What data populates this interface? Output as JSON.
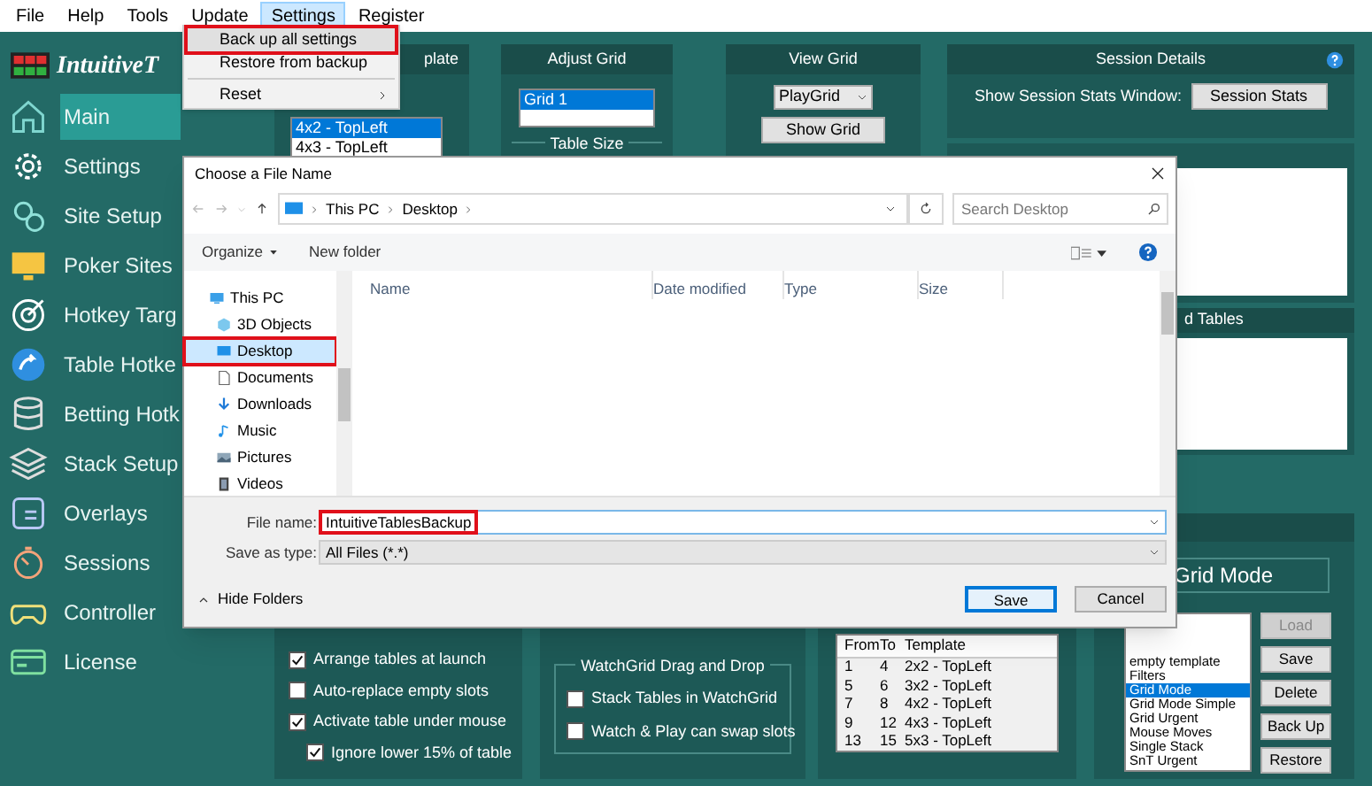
{
  "menu_bar": [
    {
      "label": "File",
      "selected": false
    },
    {
      "label": "Help",
      "selected": false
    },
    {
      "label": "Tools",
      "selected": false
    },
    {
      "label": "Update",
      "selected": false
    },
    {
      "label": "Settings",
      "selected": true
    },
    {
      "label": "Register",
      "selected": false
    }
  ],
  "settings_menu": [
    {
      "kind": "item",
      "label": "Back up all settings",
      "hovered": true,
      "red_frame": true,
      "submenu": false
    },
    {
      "kind": "item",
      "label": "Restore from backup",
      "hovered": false,
      "red_frame": false,
      "submenu": false
    },
    {
      "kind": "separator"
    },
    {
      "kind": "item",
      "label": "Reset",
      "hovered": false,
      "red_frame": false,
      "submenu": true
    }
  ],
  "logo": "IntuitiveT",
  "sidebar": [
    {
      "label": "Main",
      "selected": true
    },
    {
      "label": "Settings",
      "selected": false
    },
    {
      "label": "Site Setup",
      "selected": false
    },
    {
      "label": "Poker Sites",
      "selected": false
    },
    {
      "label": "Hotkey Targ",
      "selected": false
    },
    {
      "label": "Table Hotke",
      "selected": false
    },
    {
      "label": "Betting Hotk",
      "selected": false
    },
    {
      "label": "Stack Setup",
      "selected": false
    },
    {
      "label": "Overlays",
      "selected": false
    },
    {
      "label": "Sessions",
      "selected": false
    },
    {
      "label": "Controller",
      "selected": false
    },
    {
      "label": "License",
      "selected": false
    }
  ],
  "template_panel": {
    "title": "plate",
    "items": [
      {
        "label": "4x2 - TopLeft",
        "selected": true
      },
      {
        "label": "4x3 - TopLeft",
        "selected": false
      }
    ]
  },
  "adjust_grid": {
    "title": "Adjust Grid",
    "grids": [
      {
        "label": "Grid 1",
        "selected": true
      }
    ],
    "group_label": "Table Size"
  },
  "view_grid": {
    "title": "View Grid",
    "grid_select": "PlayGrid",
    "button": "Show Grid"
  },
  "session_details": {
    "title": "Session Details",
    "label": "Show Session Stats Window:",
    "button": "Session Stats"
  },
  "tables_panel": {
    "title": "d Tables"
  },
  "launch_options": [
    {
      "label": "Arrange tables at launch",
      "checked": true
    },
    {
      "label": "Auto-replace empty slots",
      "checked": false
    },
    {
      "label": "Activate table under mouse",
      "checked": true,
      "children": [
        {
          "label": "Ignore lower 15% of table",
          "checked": true
        }
      ]
    }
  ],
  "watchgrid_drag_drop": {
    "title": "WatchGrid Drag and Drop",
    "options": [
      {
        "label": "Stack Tables in WatchGrid",
        "checked": false
      },
      {
        "label": "Watch & Play can swap slots",
        "checked": false
      }
    ]
  },
  "table_ranges": {
    "columns": [
      "From",
      "To",
      "Template"
    ],
    "rows": [
      [
        "1",
        "4",
        "2x2 - TopLeft"
      ],
      [
        "5",
        "6",
        "3x2 - TopLeft"
      ],
      [
        "7",
        "8",
        "4x2 - TopLeft"
      ],
      [
        "9",
        "12",
        "4x3 - TopLeft"
      ],
      [
        "13",
        "15",
        "5x3 - TopLeft"
      ]
    ]
  },
  "templates_panel": {
    "mode": "Grid Mode",
    "templates": [
      {
        "label": "empty template",
        "selected": false
      },
      {
        "label": "Filters",
        "selected": false
      },
      {
        "label": "Grid Mode",
        "selected": true
      },
      {
        "label": "Grid Mode Simple",
        "selected": false
      },
      {
        "label": "Grid Urgent",
        "selected": false
      },
      {
        "label": "Mouse Moves",
        "selected": false
      },
      {
        "label": "Single Stack",
        "selected": false
      },
      {
        "label": "SnT Urgent",
        "selected": false
      }
    ],
    "buttons": [
      {
        "label": "Load",
        "disabled": true
      },
      {
        "label": "Save",
        "disabled": false
      },
      {
        "label": "Delete",
        "disabled": false
      },
      {
        "label": "Back Up",
        "disabled": false
      },
      {
        "label": "Restore",
        "disabled": false
      }
    ]
  },
  "dialog": {
    "title": "Choose a File Name",
    "breadcrumb": [
      "This PC",
      "Desktop"
    ],
    "search_placeholder": "Search Desktop",
    "toolbar": [
      "Organize",
      "New folder"
    ],
    "tree": [
      {
        "label": "This PC",
        "selected": false,
        "red_frame": false,
        "children": [
          {
            "label": "3D Objects",
            "selected": false,
            "red_frame": false
          },
          {
            "label": "Desktop",
            "selected": true,
            "red_frame": true
          },
          {
            "label": "Documents",
            "selected": false,
            "red_frame": false
          },
          {
            "label": "Downloads",
            "selected": false,
            "red_frame": false
          },
          {
            "label": "Music",
            "selected": false,
            "red_frame": false
          },
          {
            "label": "Pictures",
            "selected": false,
            "red_frame": false
          },
          {
            "label": "Videos",
            "selected": false,
            "red_frame": false
          }
        ]
      }
    ],
    "columns": [
      "Name",
      "Date modified",
      "Type",
      "Size"
    ],
    "file_name_label": "File name:",
    "file_name": "IntuitiveTablesBackup",
    "file_name_red_frame": true,
    "save_type_label": "Save as type:",
    "save_type": "All Files (*.*)",
    "hide_folders": "Hide Folders",
    "buttons": [
      {
        "label": "Save",
        "default": true
      },
      {
        "label": "Cancel",
        "default": false
      }
    ]
  }
}
